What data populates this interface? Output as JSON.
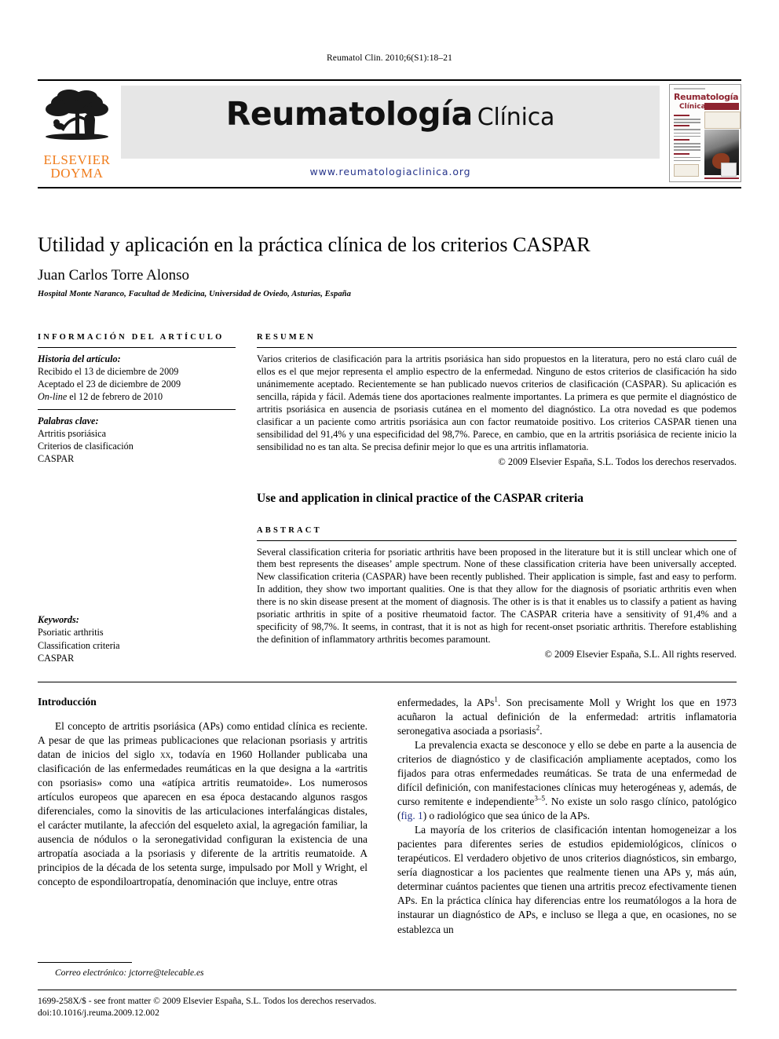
{
  "running_head": "Reumatol Clin. 2010;6(S1):18–21",
  "masthead": {
    "publisher_line1": "ELSEVIER",
    "publisher_line2": "DOYMA",
    "journal_title_main": "Reumatología",
    "journal_title_sub": "Clínica",
    "journal_url": "www.reumatologiaclinica.org",
    "cover": {
      "title_main": "Reumatología",
      "title_sub": "Clínica"
    },
    "colors": {
      "elsevier_orange": "#F07C1B",
      "band_grey": "#e6e6e6",
      "url_blue": "#26348B",
      "cover_maroon": "#8E2430"
    }
  },
  "article": {
    "title": "Utilidad y aplicación en la práctica clínica de los criterios CASPAR",
    "author": "Juan Carlos Torre Alonso",
    "affiliation": "Hospital Monte Naranco, Facultad de Medicina, Universidad de Oviedo, Asturias, España"
  },
  "info": {
    "heading": "INFORMACIÓN DEL ARTÍCULO",
    "history_label": "Historia del artículo:",
    "history": [
      "Recibido el 13 de diciembre de 2009",
      "Aceptado el 23 de diciembre de 2009"
    ],
    "online_prefix": "On-line",
    "online_rest": " el 12 de febrero de 2010",
    "keywords_es_label": "Palabras clave:",
    "keywords_es": [
      "Artritis psoriásica",
      "Criterios de clasificación",
      "CASPAR"
    ],
    "keywords_en_label": "Keywords:",
    "keywords_en": [
      "Psoriatic arthritis",
      "Classification criteria",
      "CASPAR"
    ]
  },
  "abstract_es": {
    "heading": "RESUMEN",
    "body": "Varios criterios de clasificación para la artritis psoriásica han sido propuestos en la literatura, pero no está claro cuál de ellos es el que mejor representa el amplio espectro de la enfermedad. Ninguno de estos criterios de clasificación ha sido unánimemente aceptado. Recientemente se han publicado nuevos criterios de clasificación (CASPAR). Su aplicación es sencilla, rápida y fácil. Además tiene dos aportaciones realmente importantes. La primera es que permite el diagnóstico de artritis psoriásica en ausencia de psoriasis cutánea en el momento del diagnóstico. La otra novedad es que podemos clasificar a un paciente como artritis psoriásica aun con factor reumatoide positivo. Los criterios CASPAR tienen una sensibilidad del 91,4% y una especificidad del 98,7%. Parece, en cambio, que en la artritis psoriásica de reciente inicio la sensibilidad no es tan alta. Se precisa definir mejor lo que es una artritis inflamatoria.",
    "copyright": "© 2009 Elsevier España, S.L. Todos los derechos reservados."
  },
  "abstract_en": {
    "title": "Use and application in clinical practice of the CASPAR criteria",
    "heading": "ABSTRACT",
    "body": "Several classification criteria for psoriatic arthritis have been proposed in the literature but it is still unclear which one of them best represents the diseases’ ample spectrum. None of these classification criteria have been universally accepted. New classification criteria (CASPAR) have been recently published. Their application is simple, fast and easy to perform. In addition, they show two important qualities. One is that they allow for the diagnosis of psoriatic arthritis even when there is no skin disease present at the moment of diagnosis. The other is is that it enables us to classify a patient as having psoriatic arthritis in spite of a positive rheumatoid factor. The CASPAR criteria have a sensitivity of 91,4% and a specificity of 98,7%. It seems, in contrast, that it is not as high for recent-onset psoriatic arthritis. Therefore establishing the definition of inflammatory arthritis becomes paramount.",
    "copyright": "© 2009 Elsevier España, S.L. All rights reserved."
  },
  "body": {
    "section_heading": "Introducción",
    "left_paragraph_1_a": "El concepto de artritis psoriásica (APs) como entidad clínica es reciente. A pesar de que las primeas publicaciones que relacionan psoriasis y artritis datan de inicios del siglo ",
    "left_paragraph_1_smallcaps": "xx",
    "left_paragraph_1_b": ", todavía en 1960 Hollander publicaba una clasificación de las enfermedades reumáticas en la que designa a la «artritis con psoriasis» como una «atípica artritis reumatoide». Los numerosos artículos europeos que aparecen en esa época destacando algunos rasgos diferenciales, como la sinovitis de las articulaciones interfalángicas distales, el carácter mutilante, la afección del esqueleto axial, la agregación familiar, la ausencia de nódulos o la seronegatividad configuran la existencia de una artropatía asociada a la psoriasis y diferente de la artritis reumatoide. A principios de la década de los setenta surge, impulsado por Moll y Wright, el concepto de espondiloartropatía, denominación que incluye, entre otras",
    "right_paragraph_1_a": "enfermedades, la APs",
    "right_paragraph_1_ref1": "1",
    "right_paragraph_1_b": ". Son precisamente Moll y Wright los que en 1973 acuñaron la actual definición de la enfermedad: artritis inflamatoria seronegativa asociada a psoriasis",
    "right_paragraph_1_ref2": "2",
    "right_paragraph_1_c": ".",
    "right_paragraph_2_a": "La prevalencia exacta se desconoce y ello se debe en parte a la ausencia de criterios de diagnóstico y de clasificación ampliamente aceptados, como los fijados para otras enfermedades reumáticas. Se trata de una enfermedad de difícil definición, con manifestaciones clínicas muy heterogéneas y, además, de curso remitente e independiente",
    "right_paragraph_2_ref": "3–5",
    "right_paragraph_2_b": ". No existe un solo rasgo clínico, patológico (",
    "right_paragraph_2_figlink": "fig. 1",
    "right_paragraph_2_c": ") o radiológico que sea único de la APs.",
    "right_paragraph_3": "La mayoría de los criterios de clasificación intentan homogeneizar a los pacientes para diferentes series de estudios epidemiológicos, clínicos o terapéuticos. El verdadero objetivo de unos criterios diagnósticos, sin embargo, sería diagnosticar a los pacientes que realmente tienen una APs y, más aún, determinar cuántos pacientes que tienen una artritis precoz efectivamente tienen APs. En la práctica clínica hay diferencias entre los reumatólogos a la hora de instaurar un diagnóstico de APs, e incluso se llega a que, en ocasiones, no se establezca un"
  },
  "footnote": {
    "label": "Correo electrónico:",
    "email": " jctorre@telecable.es"
  },
  "bottom": {
    "line1": "1699-258X/$ - see front matter © 2009 Elsevier España, S.L. Todos los derechos reservados.",
    "line2": "doi:10.1016/j.reuma.2009.12.002"
  }
}
